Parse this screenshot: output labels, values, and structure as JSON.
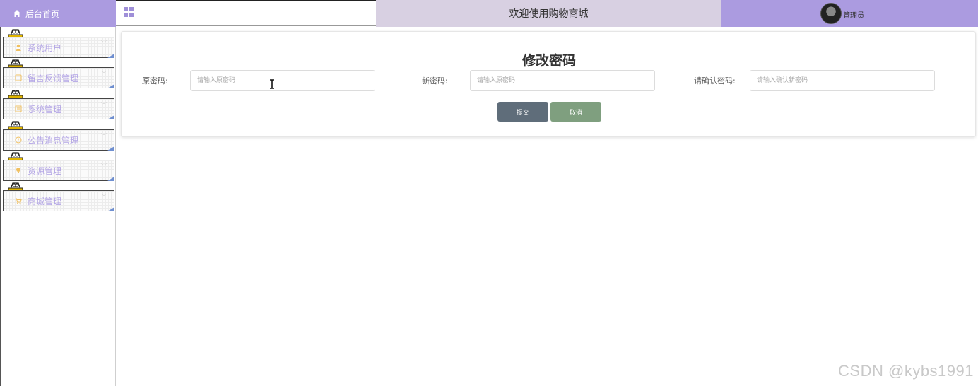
{
  "header": {
    "home_label": "后台首页",
    "title": "欢迎使用购物商城",
    "user_name": "管理员"
  },
  "sidebar": {
    "items": [
      {
        "label": "系统用户",
        "icon": "user-icon"
      },
      {
        "label": "留言反馈管理",
        "icon": "feedback-icon"
      },
      {
        "label": "系统管理",
        "icon": "system-icon"
      },
      {
        "label": "公告消息管理",
        "icon": "notice-icon"
      },
      {
        "label": "资源管理",
        "icon": "resource-icon"
      },
      {
        "label": "商城管理",
        "icon": "cart-icon"
      }
    ]
  },
  "form": {
    "title": "修改密码",
    "old_password_label": "原密码:",
    "old_password_placeholder": "请输入原密码",
    "new_password_label": "新密码:",
    "new_password_placeholder": "请输入原密码",
    "confirm_password_label": "请确认密码:",
    "confirm_password_placeholder": "请输入确认新密码",
    "submit_label": "提交",
    "cancel_label": "取消"
  },
  "watermark": "CSDN @kybs1991",
  "colors": {
    "accent_purple": "#ab9be0",
    "header_title_bg": "#d8d0e2",
    "submit_button": "#5f6d7a",
    "cancel_button": "#7f9f7f"
  }
}
